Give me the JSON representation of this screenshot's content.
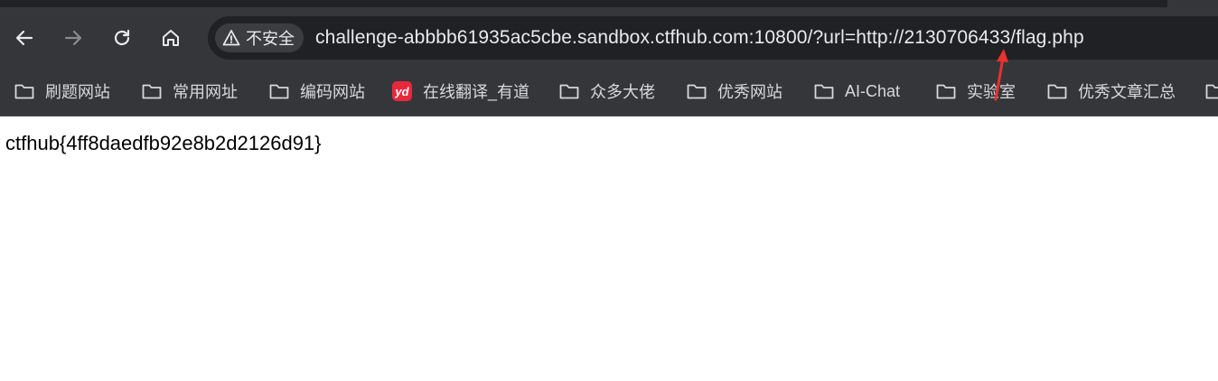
{
  "toolbar": {
    "back_icon": "arrow-left-icon",
    "forward_icon": "arrow-right-icon",
    "reload_icon": "reload-icon",
    "home_icon": "home-icon"
  },
  "omnibox": {
    "security_label": "不安全",
    "security_icon": "warning-triangle-icon",
    "url": "challenge-abbbb61935ac5cbe.sandbox.ctfhub.com:10800/?url=http://2130706433/flag.php"
  },
  "bookmarks": [
    {
      "label": "刷题网站",
      "icon": "folder-icon"
    },
    {
      "label": "常用网址",
      "icon": "folder-icon"
    },
    {
      "label": "编码网站",
      "icon": "folder-icon"
    },
    {
      "label": "在线翻译_有道",
      "icon": "youdao-logo",
      "logo_text": "yd"
    },
    {
      "label": "众多大佬",
      "icon": "folder-icon"
    },
    {
      "label": "优秀网站",
      "icon": "folder-icon"
    },
    {
      "label": "AI-Chat",
      "icon": "folder-icon"
    },
    {
      "label": "实验室",
      "icon": "folder-icon"
    },
    {
      "label": "优秀文章汇总",
      "icon": "folder-icon"
    }
  ],
  "page": {
    "body_text": "ctfhub{4ff8daedfb92e8b2d2126d91}"
  },
  "colors": {
    "toolbar_bg": "#35363a",
    "omnibox_bg": "#202124",
    "text_light": "#e8eaed",
    "annotation_red": "#e8322e",
    "youdao_red": "#e8293d"
  }
}
